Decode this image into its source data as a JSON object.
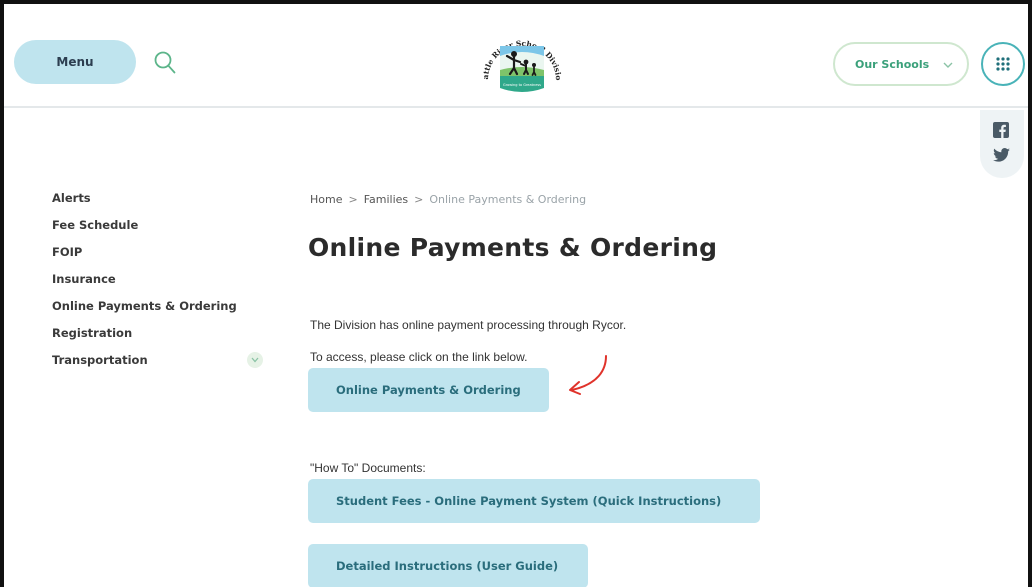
{
  "header": {
    "menu_label": "Menu",
    "logo": {
      "arc_text": "Battle River School Division",
      "banner_text": "Growing to Greatness"
    },
    "our_schools_label": "Our Schools"
  },
  "icons": {
    "search": "search-icon",
    "chevron": "chevron-down-icon",
    "apps": "grid-icon",
    "facebook": "facebook-icon",
    "twitter": "twitter-icon",
    "annotation": "red-arrow-annotation"
  },
  "sidebar": {
    "items": [
      {
        "label": "Alerts"
      },
      {
        "label": "Fee Schedule"
      },
      {
        "label": "FOIP"
      },
      {
        "label": "Insurance"
      },
      {
        "label": "Online Payments & Ordering"
      },
      {
        "label": "Registration"
      },
      {
        "label": "Transportation"
      }
    ]
  },
  "breadcrumb": {
    "home": "Home",
    "sep": ">",
    "families": "Families",
    "current": "Online Payments & Ordering"
  },
  "main": {
    "title": "Online Payments & Ordering",
    "intro": "The Division has online payment processing through Rycor.",
    "access_text": "To access, please click on the link below.",
    "online_button": "Online Payments & Ordering",
    "howto_label": "\"How To\" Documents:",
    "quick_instructions_button": "Student Fees - Online Payment System (Quick Instructions)",
    "user_guide_button": "Detailed Instructions (User Guide)"
  },
  "colors": {
    "button_bg": "#bfe4ee",
    "button_text": "#2a6d7c",
    "accent_teal": "#49b3b8",
    "accent_green": "#3aa07a",
    "annotation_red": "#e0332b"
  }
}
